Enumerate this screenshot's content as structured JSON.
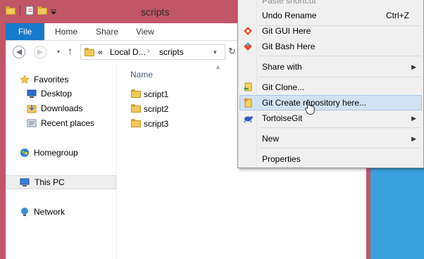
{
  "window": {
    "title": "scripts",
    "ribbon_tabs": [
      "File",
      "Home",
      "Share",
      "View"
    ]
  },
  "address_bar": {
    "prefix": "«",
    "crumbs": [
      "Local D...",
      "scripts"
    ],
    "back_icon": "back-arrow-icon",
    "forward_icon": "forward-arrow-icon",
    "up_icon": "up-arrow-icon",
    "refresh_icon": "refresh-icon"
  },
  "nav_pane": {
    "favorites_label": "Favorites",
    "favorites": [
      "Desktop",
      "Downloads",
      "Recent places"
    ],
    "homegroup_label": "Homegroup",
    "thispc_label": "This PC",
    "network_label": "Network"
  },
  "file_list": {
    "column_header": "Name",
    "items": [
      "script1",
      "script2",
      "script3"
    ]
  },
  "context_menu": {
    "items": [
      {
        "label": "Paste shortcut",
        "shortcut": "",
        "submenu": false
      },
      {
        "label": "Undo Rename",
        "shortcut": "Ctrl+Z",
        "submenu": false
      },
      {
        "label": "Git GUI Here",
        "shortcut": "",
        "submenu": false
      },
      {
        "label": "Git Bash Here",
        "shortcut": "",
        "submenu": false
      },
      {
        "label": "Share with",
        "shortcut": "",
        "submenu": true
      },
      {
        "label": "Git Clone...",
        "shortcut": "",
        "submenu": false
      },
      {
        "label": "Git Create repository here...",
        "shortcut": "",
        "submenu": false,
        "highlighted": true
      },
      {
        "label": "TortoiseGit",
        "shortcut": "",
        "submenu": true
      },
      {
        "label": "New",
        "shortcut": "",
        "submenu": true
      },
      {
        "label": "Properties",
        "shortcut": "",
        "submenu": false
      }
    ]
  },
  "colors": {
    "window_frame": "#c15667",
    "file_tab": "#1979ca",
    "menu_highlight": "#d1e2f2",
    "desktop": "#1f8fc9"
  }
}
